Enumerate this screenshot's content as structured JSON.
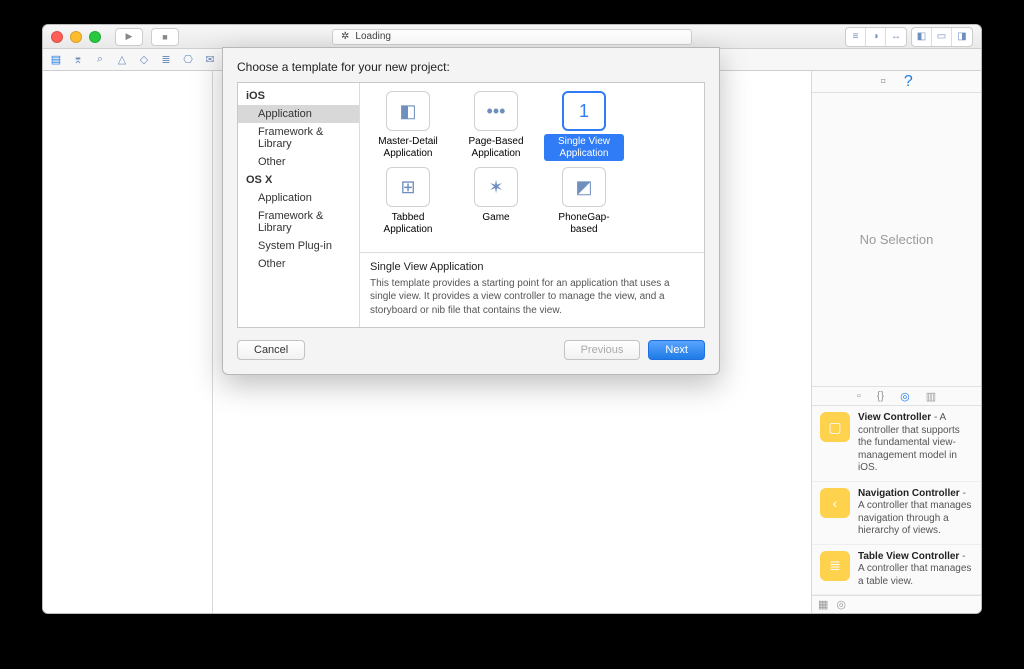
{
  "titlebar": {
    "loading": "Loading"
  },
  "inspector": {
    "no_selection": "No Selection"
  },
  "library": [
    {
      "title": "View Controller",
      "body": "A controller that supports the fundamental view-management model in iOS.",
      "glyph": "▢"
    },
    {
      "title": "Navigation Controller",
      "body": "A controller that manages navigation through a hierarchy of views.",
      "glyph": "‹"
    },
    {
      "title": "Table View Controller",
      "body": "A controller that manages a table view.",
      "glyph": "≣"
    }
  ],
  "sheet": {
    "title": "Choose a template for your new project:",
    "categories": [
      {
        "name": "iOS",
        "items": [
          "Application",
          "Framework & Library",
          "Other"
        ],
        "selected": 0
      },
      {
        "name": "OS X",
        "items": [
          "Application",
          "Framework & Library",
          "System Plug-in",
          "Other"
        ],
        "selected": -1
      }
    ],
    "templates": [
      {
        "label": "Master-Detail Application",
        "glyph": "◧"
      },
      {
        "label": "Page-Based Application",
        "glyph": "•••"
      },
      {
        "label": "Single View Application",
        "glyph": "1",
        "selected": true
      },
      {
        "label": "Tabbed Application",
        "glyph": "⊞"
      },
      {
        "label": "Game",
        "glyph": "✶"
      },
      {
        "label": "PhoneGap-based",
        "glyph": "◩"
      }
    ],
    "desc": {
      "heading": "Single View Application",
      "body": "This template provides a starting point for an application that uses a single view. It provides a view controller to manage the view, and a storyboard or nib file that contains the view."
    },
    "buttons": {
      "cancel": "Cancel",
      "prev": "Previous",
      "next": "Next"
    }
  }
}
